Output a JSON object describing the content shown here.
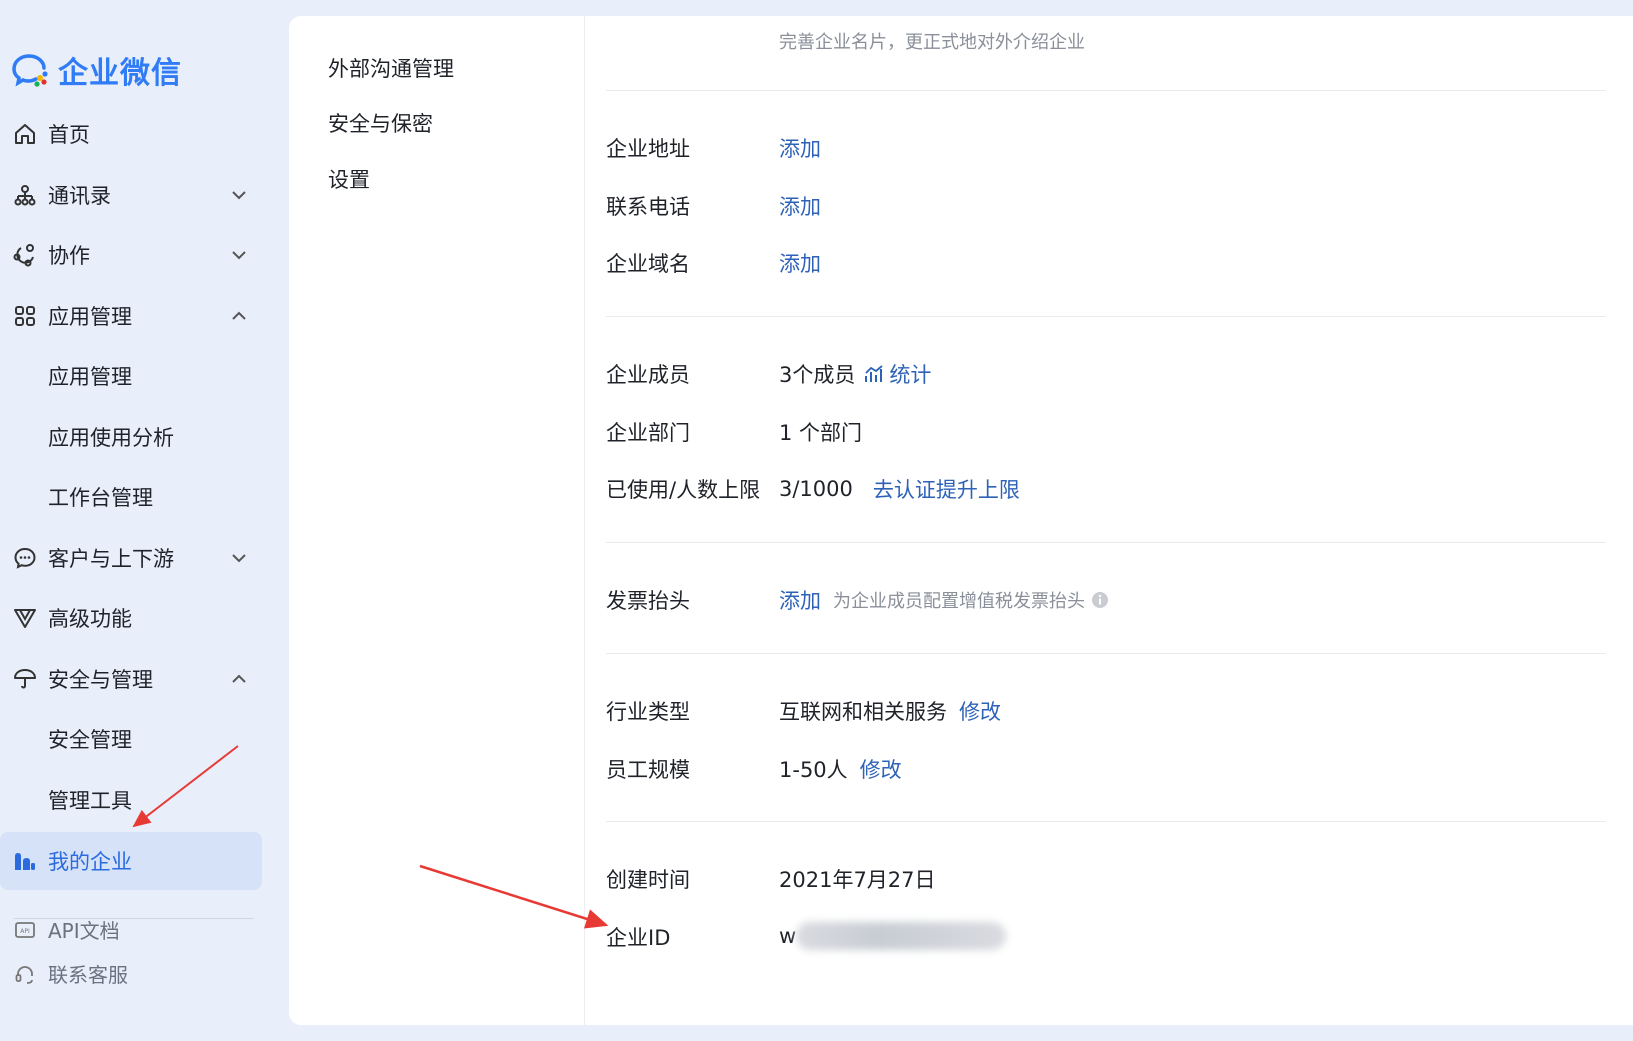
{
  "brand": {
    "name": "企业微信",
    "primary_color": "#2f7cf6"
  },
  "sidebar": {
    "items": [
      {
        "label": "首页",
        "icon": "home-icon"
      },
      {
        "label": "通讯录",
        "icon": "contacts-icon",
        "chevron": "down"
      },
      {
        "label": "协作",
        "icon": "collaboration-icon",
        "chevron": "down"
      },
      {
        "label": "应用管理",
        "icon": "apps-icon",
        "chevron": "up"
      },
      {
        "label": "应用管理",
        "sub": true
      },
      {
        "label": "应用使用分析",
        "sub": true
      },
      {
        "label": "工作台管理",
        "sub": true
      },
      {
        "label": "客户与上下游",
        "icon": "chat-bubble-icon",
        "chevron": "down"
      },
      {
        "label": "高级功能",
        "icon": "advanced-icon"
      },
      {
        "label": "安全与管理",
        "icon": "umbrella-icon",
        "chevron": "up"
      },
      {
        "label": "安全管理",
        "sub": true
      },
      {
        "label": "管理工具",
        "sub": true
      },
      {
        "label": "我的企业",
        "icon": "enterprise-icon",
        "active": true
      }
    ],
    "footer": [
      {
        "label": "API文档",
        "icon": "api-doc-icon"
      },
      {
        "label": "联系客服",
        "icon": "headset-icon"
      }
    ]
  },
  "subnav": {
    "items": [
      "外部沟通管理",
      "安全与保密",
      "设置"
    ]
  },
  "info": {
    "top_note": "完善企业名片，更正式地对外介绍企业",
    "address": {
      "label": "企业地址",
      "action": "添加"
    },
    "phone": {
      "label": "联系电话",
      "action": "添加"
    },
    "domain": {
      "label": "企业域名",
      "action": "添加"
    },
    "members": {
      "label": "企业成员",
      "value": "3个成员",
      "action": "统计"
    },
    "departments": {
      "label": "企业部门",
      "value": "1 个部门"
    },
    "limit": {
      "label": "已使用/人数上限",
      "value": "3/1000",
      "action": "去认证提升上限"
    },
    "invoice": {
      "label": "发票抬头",
      "action": "添加",
      "hint": "为企业成员配置增值税发票抬头"
    },
    "industry": {
      "label": "行业类型",
      "value": "互联网和相关服务",
      "action": "修改"
    },
    "scale": {
      "label": "员工规模",
      "value": "1-50人",
      "action": "修改"
    },
    "created": {
      "label": "创建时间",
      "value": "2021年7月27日"
    },
    "corp_id": {
      "label": "企业ID",
      "value_prefix": "w"
    }
  },
  "colors": {
    "link": "#2e62b8",
    "active_bg": "#d6e2f8",
    "arrow": "#e83a35"
  }
}
